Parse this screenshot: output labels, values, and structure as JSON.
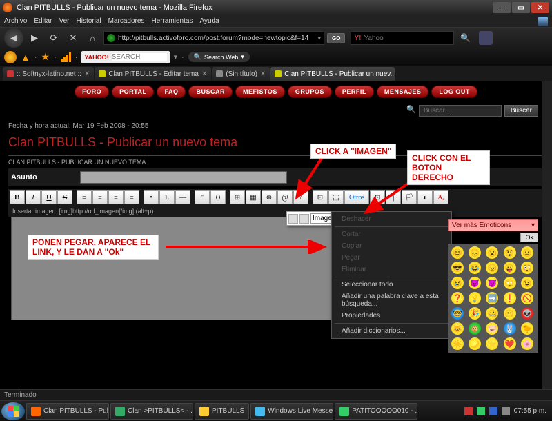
{
  "window": {
    "title": "Clan PITBULLS - Publicar un nuevo tema - Mozilla Firefox"
  },
  "menubar": {
    "items": [
      "Archivo",
      "Editar",
      "Ver",
      "Historial",
      "Marcadores",
      "Herramientas",
      "Ayuda"
    ]
  },
  "nav": {
    "url": "http://pitbulls.activoforo.com/post.forum?mode=newtopic&f=14",
    "go": "GO",
    "search_engine": "Yahoo",
    "search_placeholder": ""
  },
  "yahoo_toolbar": {
    "logo": "YAHOO!",
    "search_label": "SEARCH",
    "searchweb": "Search Web"
  },
  "tabs": [
    {
      "label": ":: Softnyx-latino.net ::",
      "color": "#c33"
    },
    {
      "label": "Clan PITBULLS - Editar tema",
      "color": "#cc0"
    },
    {
      "label": "(Sin título)",
      "color": "#888"
    },
    {
      "label": "Clan PITBULLS - Publicar un nuev...",
      "color": "#cc0",
      "active": true
    }
  ],
  "forum_nav": [
    "Foro",
    "Portal",
    "FAQ",
    "Buscar",
    "Mefistos",
    "Grupos",
    "Perfil",
    "Mensajes",
    "Log Out"
  ],
  "search": {
    "placeholder": "Buscar...",
    "button": "Buscar"
  },
  "post": {
    "datetime": "Fecha y hora actual: Mar 19 Feb 2008 - 20:55",
    "title": "Clan PITBULLS - Publicar un nuevo tema",
    "breadcrumb": "CLAN PITBULLS - PUBLICAR UN NUEVO TEMA",
    "subject_label": "Asunto",
    "hint": "Insertar imagen: [img]http://url_imagen[/img] (alt+p)",
    "otros": "Otros",
    "toolbar": [
      "B",
      "I",
      "U",
      "S",
      "",
      "≡",
      "≡",
      "≡",
      "≡",
      "",
      "•",
      "1.",
      "—",
      "",
      "\"",
      "⟨⟩",
      "",
      "⊞",
      "▦",
      "⊕",
      "@",
      "/",
      "",
      "⊡",
      "⬚"
    ],
    "toolbar2": [
      "⊡",
      "|",
      "🏳",
      "◐",
      "Aₐ"
    ]
  },
  "image_popup": {
    "label": "Imagen"
  },
  "context_menu": {
    "items_disabled": [
      "Deshacer",
      "Cortar",
      "Copiar",
      "Pegar",
      "Eliminar"
    ],
    "items": [
      "Seleccionar todo",
      "Añadir una palabra clave a esta búsqueda...",
      "Propiedades"
    ],
    "items2": [
      "Añadir diccionarios..."
    ]
  },
  "emoticons": {
    "header": "Ver más Emoticons",
    "ok": "Ok"
  },
  "annotations": {
    "click_imagen": "CLICK A \"IMAGEN\"",
    "click_derecho": "CLICK CON EL BOTON DERECHO",
    "pegar": "PONEN PEGAR, APARECE EL LINK, Y LE DAN A \"Ok\""
  },
  "status": {
    "text": "Terminado"
  },
  "taskbar": {
    "items": [
      "Clan PITBULLS - Publi...",
      "Clan >PITBULLS< - ...",
      "PITBULLS",
      "Windows Live Messe...",
      "PATITOOOOO010 - ..."
    ],
    "time": "07:55 p.m."
  }
}
